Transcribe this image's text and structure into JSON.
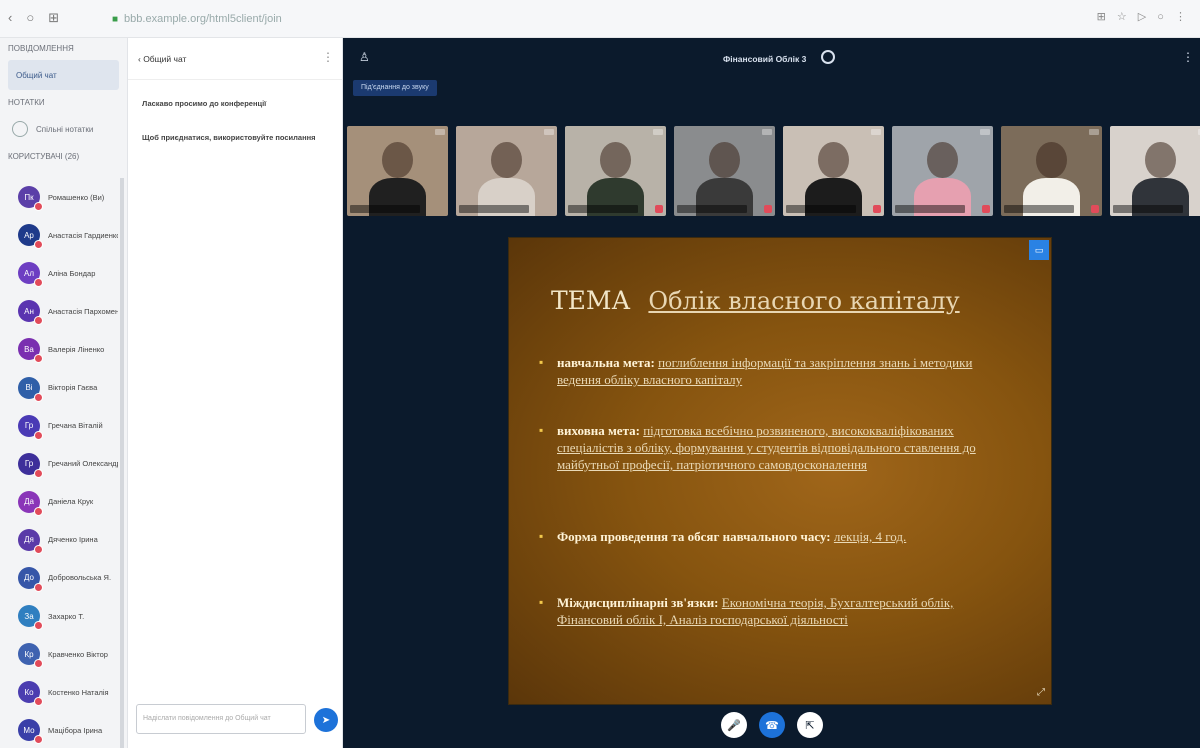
{
  "browser": {
    "url": "bbb.example.org/html5client/join",
    "nav_back": "‹",
    "nav_reload": "○",
    "nav_grid": "⊞",
    "right_icons": "⊞ ☆ ▷ ○ ⋮"
  },
  "users_panel": {
    "messages_title": "ПОВІДОМЛЕННЯ",
    "public_chat": "Общий чат",
    "notes_title": "НОТАТКИ",
    "shared_notes": "Спільні нотатки",
    "users_title": "КОРИСТУВАЧІ (26)",
    "users": [
      {
        "initials": "Пк",
        "name": "Ромашенко (Ви)",
        "color": "#5b3fa8"
      },
      {
        "initials": "Ар",
        "name": "Анастасія Гардиенко",
        "color": "#1e3a8a"
      },
      {
        "initials": "Ал",
        "name": "Аліна Бондар",
        "color": "#6d3ec2"
      },
      {
        "initials": "Ан",
        "name": "Анастасія Пархоменко",
        "color": "#5a34b0"
      },
      {
        "initials": "Ва",
        "name": "Валерія Ліненко",
        "color": "#7a2fb0"
      },
      {
        "initials": "Ві",
        "name": "Вікторія Гаєва",
        "color": "#2f5fa8"
      },
      {
        "initials": "Гр",
        "name": "Гречана Віталій",
        "color": "#4a3ab5"
      },
      {
        "initials": "Гр",
        "name": "Гречаний Олександр",
        "color": "#3d2f9a"
      },
      {
        "initials": "Да",
        "name": "Даніела Крук",
        "color": "#8a35b8"
      },
      {
        "initials": "Дя",
        "name": "Дяченко Ірина",
        "color": "#5a3aa8"
      },
      {
        "initials": "До",
        "name": "Добровольська Я.",
        "color": "#3656a8"
      },
      {
        "initials": "За",
        "name": "Захарко Т.",
        "color": "#2f7fc0"
      },
      {
        "initials": "Кр",
        "name": "Кравченко Віктор",
        "color": "#3e62b0"
      },
      {
        "initials": "Ко",
        "name": "Костенко Наталія",
        "color": "#4b3db0"
      },
      {
        "initials": "Мо",
        "name": "Мацібора Ірина",
        "color": "#3a3fa8"
      }
    ]
  },
  "chat": {
    "header": "‹ Общий чат",
    "messages": [
      "Ласкаво просимо до конференції",
      "Щоб приєднатися, використовуйте посилання"
    ],
    "input_placeholder": "Надіслати повідомлення до Общий чат",
    "send": "➤"
  },
  "main": {
    "meeting_title": "Фінансовий Облік 3",
    "status": "Під'єднання до звуку",
    "participants": [
      {
        "shirt": "#202020",
        "bg": "#a5907a",
        "muted": false
      },
      {
        "shirt": "#d8d0c8",
        "bg": "#b7a79a",
        "muted": false
      },
      {
        "shirt": "#2f3a2e",
        "bg": "#b8b2a8",
        "muted": true
      },
      {
        "shirt": "#3a3a3a",
        "bg": "#8a8c8e",
        "muted": true
      },
      {
        "shirt": "#1c1c1c",
        "bg": "#c9bfb5",
        "muted": true
      },
      {
        "shirt": "#e6a0b0",
        "bg": "#9fa4aa",
        "muted": true
      },
      {
        "shirt": "#f2efe8",
        "bg": "#7c6c5a",
        "muted": true
      },
      {
        "shirt": "#30343a",
        "bg": "#d8d2cc",
        "muted": false
      }
    ]
  },
  "slide": {
    "title_prefix": "ТЕМА",
    "title_topic": "Облік власного капіталу",
    "bullets": [
      {
        "label": "навчальна мета:",
        "text": "поглиблення інформації та закріплення знань і методики ведення обліку власного капіталу"
      },
      {
        "label": "виховна мета:",
        "text": "підготовка всебічно розвиненого, висококваліфікованих спеціалістів з обліку, формування у студентів відповідального ставлення до майбутньої професії, патріотичного самовдосконалення"
      },
      {
        "label": "Форма проведення та обсяг навчального часу:",
        "text": "лекція, 4 год."
      },
      {
        "label": "Міждисциплінарні зв'язки:",
        "text": "Економічна теорія, Бухгалтерський облік, Фінансовий облік I, Аналіз господарської діяльності"
      }
    ]
  },
  "controls": {
    "mic": "🎤",
    "phone": "☎",
    "screen": "⇱"
  }
}
